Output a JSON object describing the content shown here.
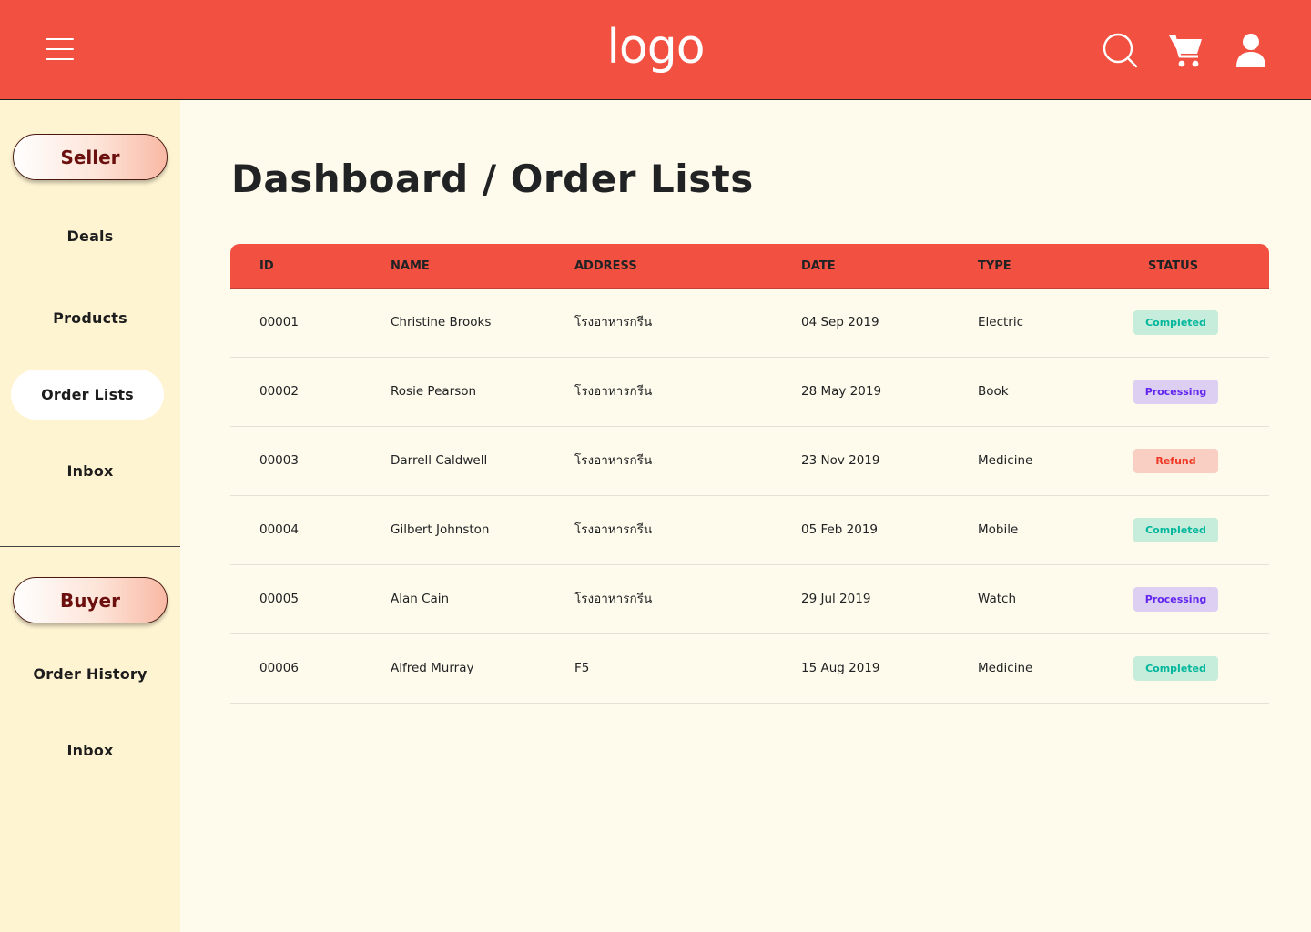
{
  "header": {
    "logo": "logo",
    "icons": [
      "menu-icon",
      "search-icon",
      "cart-icon",
      "user-icon"
    ]
  },
  "sidebar": {
    "seller_label": "Seller",
    "seller_items": [
      "Deals",
      "Products",
      "Order Lists",
      "Inbox"
    ],
    "active_item": "Order Lists",
    "buyer_label": "Buyer",
    "buyer_items": [
      "Order History",
      "Inbox"
    ]
  },
  "main": {
    "title": "Dashboard / Order Lists"
  },
  "table": {
    "columns": [
      "ID",
      "NAME",
      "ADDRESS",
      "DATE",
      "TYPE",
      "STATUS"
    ],
    "rows": [
      {
        "id": "00001",
        "name": "Christine Brooks",
        "address": "โรงอาหารกรีน",
        "date": "04 Sep 2019",
        "type": "Electric",
        "status": "Completed"
      },
      {
        "id": "00002",
        "name": "Rosie Pearson",
        "address": "โรงอาหารกรีน",
        "date": "28 May 2019",
        "type": "Book",
        "status": "Processing"
      },
      {
        "id": "00003",
        "name": "Darrell Caldwell",
        "address": "โรงอาหารกรีน",
        "date": "23 Nov 2019",
        "type": "Medicine",
        "status": "Refund"
      },
      {
        "id": "00004",
        "name": "Gilbert Johnston",
        "address": "โรงอาหารกรีน",
        "date": "05 Feb 2019",
        "type": "Mobile",
        "status": "Completed"
      },
      {
        "id": "00005",
        "name": "Alan Cain",
        "address": "โรงอาหารกรีน",
        "date": "29 Jul 2019",
        "type": "Watch",
        "status": "Processing"
      },
      {
        "id": "00006",
        "name": "Alfred Murray",
        "address": "F5",
        "date": "15 Aug 2019",
        "type": "Medicine",
        "status": "Completed"
      }
    ]
  },
  "colors": {
    "header_bg": "#F25041",
    "sidebar_bg": "#FFF4D2",
    "page_bg": "#FFFBEC",
    "completed_bg": "#C6EDDB",
    "completed_fg": "#00B69B",
    "processing_bg": "#DCCFF2",
    "processing_fg": "#6226EF",
    "refund_bg": "#F8CFC2",
    "refund_fg": "#EF3826"
  }
}
